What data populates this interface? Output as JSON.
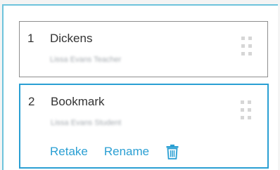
{
  "items": [
    {
      "number": "1",
      "title": "Dickens",
      "subtitle": "Lissa Evans Teacher",
      "drag_icon": "drag-handle-icon"
    },
    {
      "number": "2",
      "title": "Bookmark",
      "subtitle": "Lissa Evans Student",
      "drag_icon": "drag-handle-icon",
      "actions": {
        "retake_label": "Retake",
        "rename_label": "Rename",
        "delete_icon": "trash-icon"
      }
    }
  ],
  "colors": {
    "accent": "#2a9fd3",
    "panel_border": "#6ec3dc",
    "card_border": "#8e8e8e",
    "text": "#333333"
  }
}
